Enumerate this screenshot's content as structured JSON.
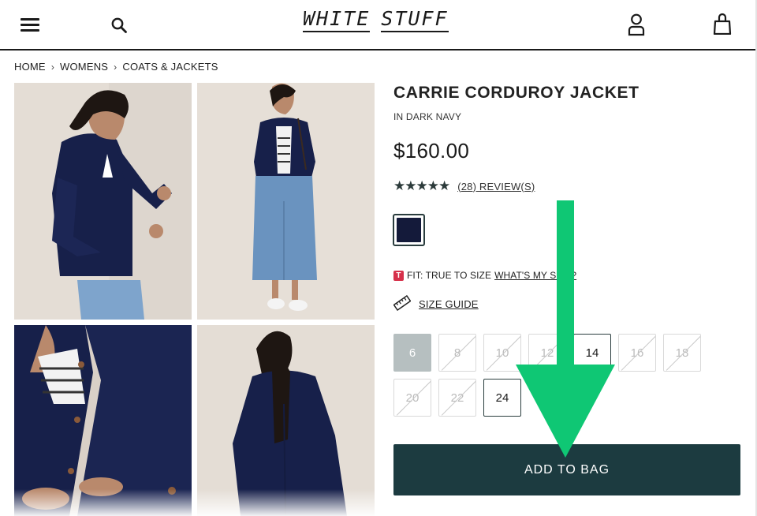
{
  "header": {
    "logo_word_1": "WHITE",
    "logo_word_2": "STUFF",
    "icons": [
      "menu-icon",
      "search-icon",
      "account-icon",
      "bag-icon"
    ]
  },
  "breadcrumb": {
    "items": [
      "HOME",
      "WOMENS",
      "COATS & JACKETS"
    ],
    "separator": "›"
  },
  "gallery": {
    "images": [
      "model-front-three-quarter",
      "model-full-length",
      "jacket-detail-closeup",
      "model-back-view"
    ]
  },
  "product": {
    "title": "CARRIE CORDUROY JACKET",
    "colour_name": "IN DARK NAVY",
    "price": "$160.00",
    "rating_stars": "★★★★★",
    "rating_value": 4.5,
    "reviews_label": "(28) REVIEW(S)",
    "swatch_color": "#141a3a",
    "fit_badge": "T",
    "fit_text": "FIT: TRUE TO SIZE",
    "fit_link": "WHAT'S MY SIZE?",
    "size_guide_label": "SIZE GUIDE",
    "sizes": [
      {
        "label": "6",
        "state": "selected"
      },
      {
        "label": "8",
        "state": "disabled"
      },
      {
        "label": "10",
        "state": "disabled"
      },
      {
        "label": "12",
        "state": "disabled"
      },
      {
        "label": "14",
        "state": "available"
      },
      {
        "label": "16",
        "state": "disabled"
      },
      {
        "label": "18",
        "state": "disabled"
      },
      {
        "label": "20",
        "state": "disabled"
      },
      {
        "label": "22",
        "state": "disabled"
      },
      {
        "label": "24",
        "state": "available"
      }
    ],
    "add_to_bag_label": "ADD TO BAG"
  },
  "colors": {
    "brand_dark_teal": "#1c3b40",
    "arrow_green": "#0fc774",
    "fit_badge_red": "#d6304a",
    "selected_size_bg": "#b6bfc0"
  }
}
